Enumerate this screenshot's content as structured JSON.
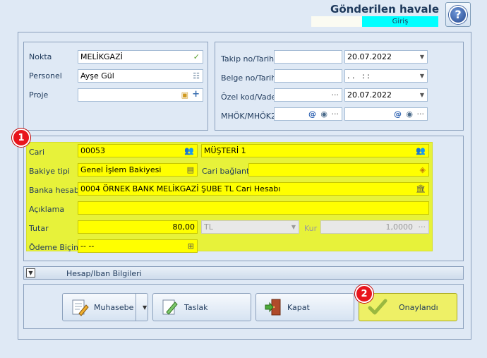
{
  "header": {
    "title": "Gönderilen havale",
    "mode": "Giriş",
    "help_icon_glyph": "?"
  },
  "top_left": {
    "nokta_label": "Nokta",
    "nokta_value": "MELİKGAZİ",
    "personel_label": "Personel",
    "personel_value": "Ayşe Gül",
    "proje_label": "Proje",
    "proje_value": ""
  },
  "top_right": {
    "takip_label": "Takip no/Tarih",
    "takip_value": "",
    "takip_date": "20.07.2022",
    "belge_label": "Belge no/Tarih",
    "belge_value": "",
    "belge_date": ". .   : :",
    "ozel_label": "Özel kod/Vade",
    "ozel_value": "",
    "ozel_date": "20.07.2022",
    "mhok_label": "MHÖK/MHÖK2",
    "mhok_value": "",
    "mhok2_value": ""
  },
  "main": {
    "badge1": "1",
    "cari_label": "Cari",
    "cari_code": "00053",
    "cari_name": "MÜŞTERİ 1",
    "bakiye_label": "Bakiye tipi",
    "bakiye_value": "Genel İşlem Bakiyesi",
    "cari_baglanti_label": "Cari bağlantı",
    "cari_baglanti_value": "",
    "banka_label": "Banka hesabı",
    "banka_value": "0004 ÖRNEK BANK MELİKGAZİ ŞUBE TL Cari Hesabı",
    "aciklama_label": "Açıklama",
    "aciklama_value": "",
    "tutar_label": "Tutar",
    "tutar_value": "80,00",
    "currency_value": "TL",
    "kur_label": "Kur",
    "kur_value": "1,0000",
    "odeme_label": "Ödeme Biçimi",
    "odeme_value": "-- --"
  },
  "collapse": {
    "label": "Hesap/Iban Bilgileri"
  },
  "buttons": {
    "muhasebe": "Muhasebe",
    "taslak": "Taslak",
    "kapat": "Kapat",
    "onaylandi": "Onaylandı",
    "badge2": "2"
  },
  "colors": {
    "highlight": "#e7f23a",
    "field_yellow": "#ffff00",
    "badge_red": "#e8141c",
    "mode_cyan": "#00ffff",
    "approve_button": "#eef066"
  }
}
